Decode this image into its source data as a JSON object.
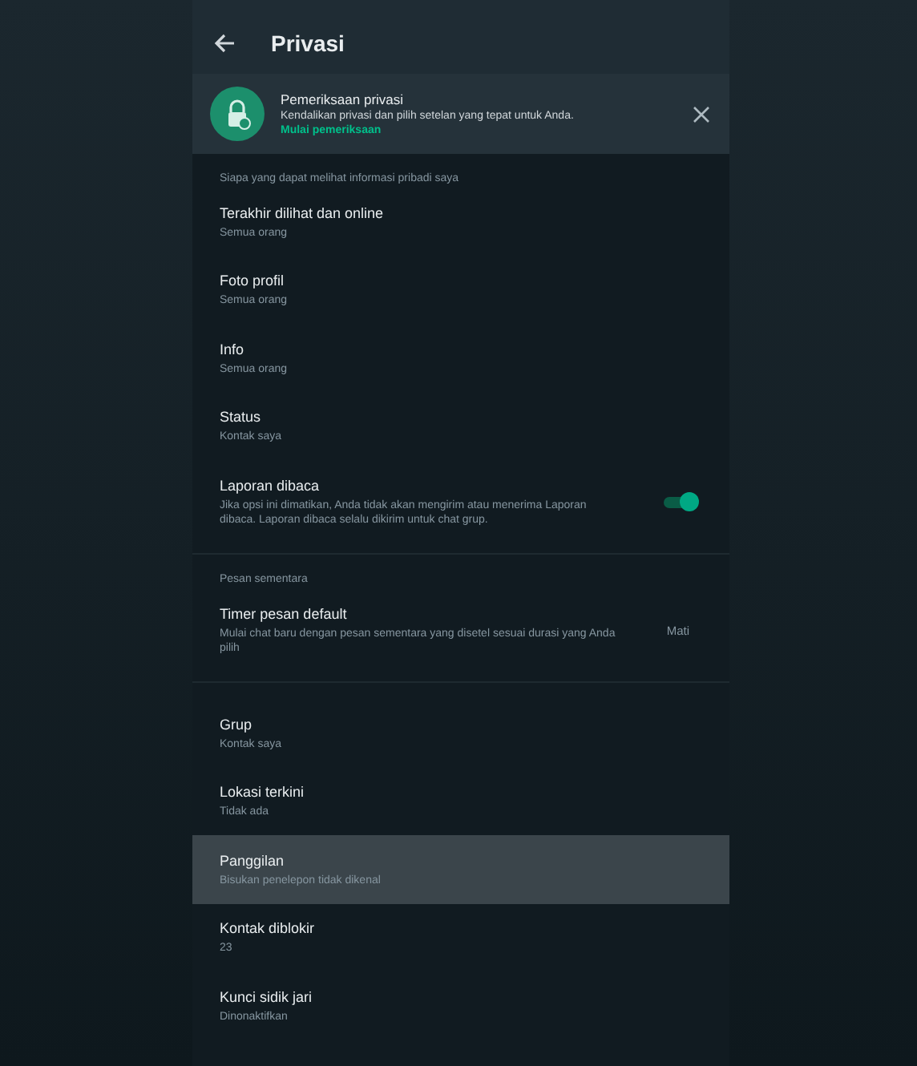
{
  "app_bar": {
    "title": "Privasi"
  },
  "banner": {
    "title": "Pemeriksaan privasi",
    "text": "Kendalikan privasi dan pilih setelan yang tepat untuk Anda.",
    "link": "Mulai pemeriksaan"
  },
  "sections": [
    {
      "header": "Siapa yang dapat melihat informasi pribadi saya",
      "items": [
        {
          "kind": "setting",
          "title": "Terakhir dilihat dan online",
          "subtitle": "Semua orang",
          "selected": false
        },
        {
          "kind": "setting",
          "title": "Foto profil",
          "subtitle": "Semua orang",
          "selected": false
        },
        {
          "kind": "setting",
          "title": "Info",
          "subtitle": "Semua orang",
          "selected": false
        },
        {
          "kind": "setting",
          "title": "Status",
          "subtitle": "Kontak saya",
          "selected": false
        },
        {
          "kind": "toggle",
          "title": "Laporan dibaca",
          "subtitle": "Jika opsi ini dimatikan, Anda tidak akan mengirim atau menerima Laporan dibaca. Laporan dibaca selalu dikirim untuk chat grup.",
          "on": true,
          "selected": false
        }
      ]
    },
    {
      "header": "Pesan sementara",
      "items": [
        {
          "kind": "value",
          "title": "Timer pesan default",
          "subtitle": "Mulai chat baru dengan pesan sementara yang disetel sesuai durasi yang Anda pilih",
          "value": "Mati",
          "selected": false
        }
      ]
    },
    {
      "items": [
        {
          "kind": "setting",
          "title": "Grup",
          "subtitle": "Kontak saya",
          "selected": false
        },
        {
          "kind": "setting",
          "title": "Lokasi terkini",
          "subtitle": "Tidak ada",
          "selected": false
        },
        {
          "kind": "setting",
          "title": "Panggilan",
          "subtitle": "Bisukan penelepon tidak dikenal",
          "selected": true
        },
        {
          "kind": "setting",
          "title": "Kontak diblokir",
          "subtitle": "23",
          "selected": false
        },
        {
          "kind": "setting",
          "title": "Kunci sidik jari",
          "subtitle": "Dinonaktifkan",
          "selected": false
        }
      ]
    }
  ]
}
